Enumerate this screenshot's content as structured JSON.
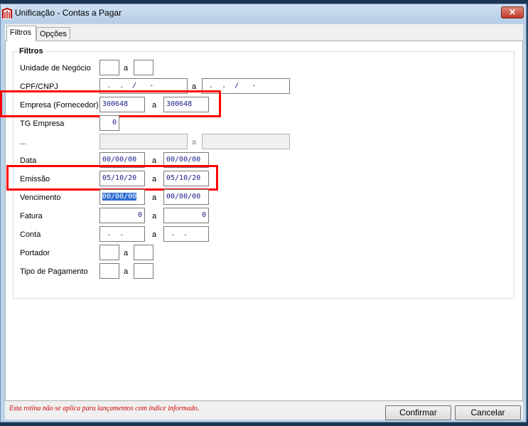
{
  "window": {
    "title": "Unificação - Contas a Pagar",
    "close_glyph": "✕",
    "icon": "app-icon"
  },
  "tabs": [
    {
      "label": "Filtros",
      "active": true
    },
    {
      "label": "Opções",
      "active": false
    }
  ],
  "filters": {
    "group_title": "Filtros",
    "range_separator": "a",
    "rows": {
      "unidade": {
        "label": "Unidade de Negócio",
        "from": "",
        "to": ""
      },
      "cpf": {
        "label": "CPF/CNPJ",
        "from": " .  .  /   -",
        "to": " .  .  /   -"
      },
      "empresa": {
        "label": "Empresa (Fornecedor)",
        "from": "300648",
        "to": "300648"
      },
      "tg": {
        "label": "TG Empresa",
        "value": "0"
      },
      "dots": {
        "label": "...",
        "from": "",
        "to": ""
      },
      "data": {
        "label": "Data",
        "from": "00/00/00",
        "to": "00/00/00"
      },
      "emissao": {
        "label": "Emissão",
        "from": "05/10/20",
        "to": "05/10/20"
      },
      "vencimento": {
        "label": "Vencimento",
        "from": "00/00/00",
        "to": "00/00/00"
      },
      "fatura": {
        "label": "Fatura",
        "from": "0",
        "to": "0"
      },
      "conta": {
        "label": "Conta",
        "from": " .  .",
        "to": " .  ."
      },
      "portador": {
        "label": "Portador",
        "from": "",
        "to": ""
      },
      "tipo": {
        "label": "Tipo de Pagamento",
        "from": "",
        "to": ""
      }
    }
  },
  "footer": {
    "note": "Esta rotina não se aplica para lançamentos com índice informado.",
    "confirm_label": "Confirmar",
    "cancel_label": "Cancelar"
  },
  "colors": {
    "annotation": "#ff0000",
    "note": "#cc0000",
    "field_text": "#1a1a8a"
  }
}
